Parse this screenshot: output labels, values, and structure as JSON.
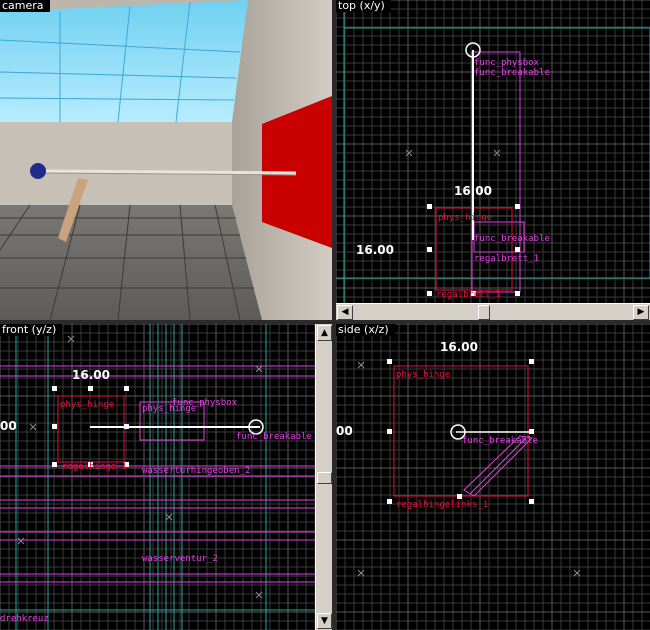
{
  "viewports": {
    "camera": {
      "label": "camera"
    },
    "top": {
      "label": "top (x/y)",
      "dim_x": "16.00",
      "dim_y": "16.00",
      "entities": [
        "func_physbox",
        "func_breakable",
        "phys_hinge",
        "func_breakable",
        "regalbrett_1",
        "regalbrett_1"
      ]
    },
    "front": {
      "label": "front (y/z)",
      "dim": "16.00",
      "edge": "00",
      "entities": [
        "phys_hinge",
        "phys_hinge",
        "func_physbox",
        "func_breakable",
        "regalhinge_1",
        "wasserturhingeoben_2",
        "wasserventur_2",
        "drehkreuz"
      ]
    },
    "side": {
      "label": "side (x/z)",
      "dim": "16.00",
      "edge": "00",
      "entities": [
        "phys_hinge",
        "func_breakable",
        "regalhingelinks_1"
      ]
    }
  },
  "scroll": {
    "left": "◀",
    "right": "▶",
    "up": "▲",
    "down": "▼"
  },
  "colors": {
    "grid": "#3a3a3a",
    "grid_major": "#5a5a5a",
    "entity_red": "#e0103a",
    "entity_magenta": "#e040e0",
    "brush_teal": "#2fa0a0"
  }
}
